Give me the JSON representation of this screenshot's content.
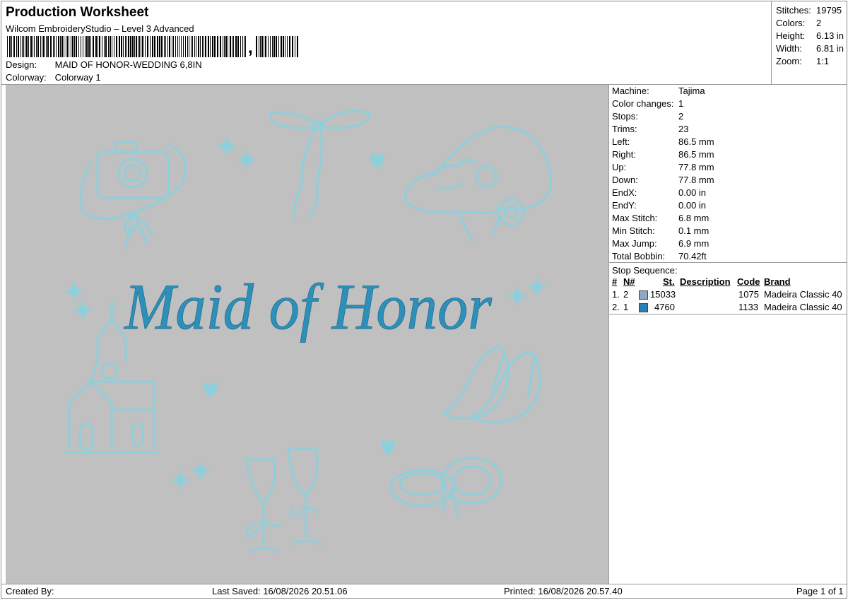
{
  "header": {
    "title": "Production Worksheet",
    "software": "Wilcom EmbroideryStudio – Level 3 Advanced",
    "barcode_comma": ",",
    "design_label": "Design:",
    "design_value": "MAID OF HONOR-WEDDING 6,8IN",
    "colorway_label": "Colorway:",
    "colorway_value": "Colorway 1"
  },
  "stats": [
    {
      "label": "Stitches:",
      "value": "19795"
    },
    {
      "label": "Colors:",
      "value": "2"
    },
    {
      "label": "Height:",
      "value": "6.13 in"
    },
    {
      "label": "Width:",
      "value": "6.81 in"
    },
    {
      "label": "Zoom:",
      "value": "1:1"
    }
  ],
  "machine": [
    {
      "label": "Machine:",
      "value": "Tajima"
    },
    {
      "label": "Color changes:",
      "value": "1"
    },
    {
      "label": "Stops:",
      "value": "2"
    },
    {
      "label": "Trims:",
      "value": "23"
    },
    {
      "label": "Left:",
      "value": "86.5 mm"
    },
    {
      "label": "Right:",
      "value": "86.5 mm"
    },
    {
      "label": "Up:",
      "value": "77.8 mm"
    },
    {
      "label": "Down:",
      "value": "77.8 mm"
    },
    {
      "label": "EndX:",
      "value": "0.00 in"
    },
    {
      "label": "EndY:",
      "value": "0.00 in"
    },
    {
      "label": "Max Stitch:",
      "value": "6.8 mm"
    },
    {
      "label": "Min Stitch:",
      "value": "0.1 mm"
    },
    {
      "label": "Max Jump:",
      "value": "6.9 mm"
    },
    {
      "label": "Total Bobbin:",
      "value": "70.42ft"
    }
  ],
  "stop_sequence": {
    "title": "Stop Sequence:",
    "columns": {
      "num": "#",
      "n": "N#",
      "st": "St.",
      "desc": "Description",
      "code": "Code",
      "brand": "Brand"
    },
    "rows": [
      {
        "num": "1.",
        "n": "2",
        "color": "#8fa8c4",
        "st": "15033",
        "code": "1075",
        "brand": "Madeira Classic 40"
      },
      {
        "num": "2.",
        "n": "1",
        "color": "#2a7fb4",
        "st": "4760",
        "code": "1133",
        "brand": "Madeira Classic 40"
      }
    ]
  },
  "design_preview": {
    "text": "Maid of Honor",
    "background": "#c0c0c0",
    "outline_color": "#8ecfdc",
    "script_color": "#2e8fb8"
  },
  "footer": {
    "created_by": "Created By:",
    "last_saved": "Last Saved: 16/08/2026 20.51.06",
    "printed": "Printed: 16/08/2026 20.57.40",
    "page": "Page 1 of 1"
  }
}
